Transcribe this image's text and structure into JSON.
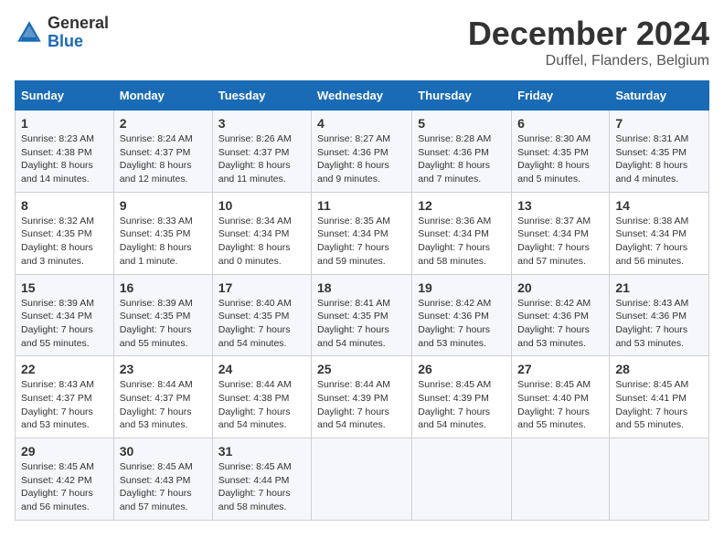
{
  "header": {
    "logo_general": "General",
    "logo_blue": "Blue",
    "month_title": "December 2024",
    "location": "Duffel, Flanders, Belgium"
  },
  "weekdays": [
    "Sunday",
    "Monday",
    "Tuesday",
    "Wednesday",
    "Thursday",
    "Friday",
    "Saturday"
  ],
  "weeks": [
    [
      {
        "day": "1",
        "sunrise": "Sunrise: 8:23 AM",
        "sunset": "Sunset: 4:38 PM",
        "daylight": "Daylight: 8 hours and 14 minutes."
      },
      {
        "day": "2",
        "sunrise": "Sunrise: 8:24 AM",
        "sunset": "Sunset: 4:37 PM",
        "daylight": "Daylight: 8 hours and 12 minutes."
      },
      {
        "day": "3",
        "sunrise": "Sunrise: 8:26 AM",
        "sunset": "Sunset: 4:37 PM",
        "daylight": "Daylight: 8 hours and 11 minutes."
      },
      {
        "day": "4",
        "sunrise": "Sunrise: 8:27 AM",
        "sunset": "Sunset: 4:36 PM",
        "daylight": "Daylight: 8 hours and 9 minutes."
      },
      {
        "day": "5",
        "sunrise": "Sunrise: 8:28 AM",
        "sunset": "Sunset: 4:36 PM",
        "daylight": "Daylight: 8 hours and 7 minutes."
      },
      {
        "day": "6",
        "sunrise": "Sunrise: 8:30 AM",
        "sunset": "Sunset: 4:35 PM",
        "daylight": "Daylight: 8 hours and 5 minutes."
      },
      {
        "day": "7",
        "sunrise": "Sunrise: 8:31 AM",
        "sunset": "Sunset: 4:35 PM",
        "daylight": "Daylight: 8 hours and 4 minutes."
      }
    ],
    [
      {
        "day": "8",
        "sunrise": "Sunrise: 8:32 AM",
        "sunset": "Sunset: 4:35 PM",
        "daylight": "Daylight: 8 hours and 3 minutes."
      },
      {
        "day": "9",
        "sunrise": "Sunrise: 8:33 AM",
        "sunset": "Sunset: 4:35 PM",
        "daylight": "Daylight: 8 hours and 1 minute."
      },
      {
        "day": "10",
        "sunrise": "Sunrise: 8:34 AM",
        "sunset": "Sunset: 4:34 PM",
        "daylight": "Daylight: 8 hours and 0 minutes."
      },
      {
        "day": "11",
        "sunrise": "Sunrise: 8:35 AM",
        "sunset": "Sunset: 4:34 PM",
        "daylight": "Daylight: 7 hours and 59 minutes."
      },
      {
        "day": "12",
        "sunrise": "Sunrise: 8:36 AM",
        "sunset": "Sunset: 4:34 PM",
        "daylight": "Daylight: 7 hours and 58 minutes."
      },
      {
        "day": "13",
        "sunrise": "Sunrise: 8:37 AM",
        "sunset": "Sunset: 4:34 PM",
        "daylight": "Daylight: 7 hours and 57 minutes."
      },
      {
        "day": "14",
        "sunrise": "Sunrise: 8:38 AM",
        "sunset": "Sunset: 4:34 PM",
        "daylight": "Daylight: 7 hours and 56 minutes."
      }
    ],
    [
      {
        "day": "15",
        "sunrise": "Sunrise: 8:39 AM",
        "sunset": "Sunset: 4:34 PM",
        "daylight": "Daylight: 7 hours and 55 minutes."
      },
      {
        "day": "16",
        "sunrise": "Sunrise: 8:39 AM",
        "sunset": "Sunset: 4:35 PM",
        "daylight": "Daylight: 7 hours and 55 minutes."
      },
      {
        "day": "17",
        "sunrise": "Sunrise: 8:40 AM",
        "sunset": "Sunset: 4:35 PM",
        "daylight": "Daylight: 7 hours and 54 minutes."
      },
      {
        "day": "18",
        "sunrise": "Sunrise: 8:41 AM",
        "sunset": "Sunset: 4:35 PM",
        "daylight": "Daylight: 7 hours and 54 minutes."
      },
      {
        "day": "19",
        "sunrise": "Sunrise: 8:42 AM",
        "sunset": "Sunset: 4:36 PM",
        "daylight": "Daylight: 7 hours and 53 minutes."
      },
      {
        "day": "20",
        "sunrise": "Sunrise: 8:42 AM",
        "sunset": "Sunset: 4:36 PM",
        "daylight": "Daylight: 7 hours and 53 minutes."
      },
      {
        "day": "21",
        "sunrise": "Sunrise: 8:43 AM",
        "sunset": "Sunset: 4:36 PM",
        "daylight": "Daylight: 7 hours and 53 minutes."
      }
    ],
    [
      {
        "day": "22",
        "sunrise": "Sunrise: 8:43 AM",
        "sunset": "Sunset: 4:37 PM",
        "daylight": "Daylight: 7 hours and 53 minutes."
      },
      {
        "day": "23",
        "sunrise": "Sunrise: 8:44 AM",
        "sunset": "Sunset: 4:37 PM",
        "daylight": "Daylight: 7 hours and 53 minutes."
      },
      {
        "day": "24",
        "sunrise": "Sunrise: 8:44 AM",
        "sunset": "Sunset: 4:38 PM",
        "daylight": "Daylight: 7 hours and 54 minutes."
      },
      {
        "day": "25",
        "sunrise": "Sunrise: 8:44 AM",
        "sunset": "Sunset: 4:39 PM",
        "daylight": "Daylight: 7 hours and 54 minutes."
      },
      {
        "day": "26",
        "sunrise": "Sunrise: 8:45 AM",
        "sunset": "Sunset: 4:39 PM",
        "daylight": "Daylight: 7 hours and 54 minutes."
      },
      {
        "day": "27",
        "sunrise": "Sunrise: 8:45 AM",
        "sunset": "Sunset: 4:40 PM",
        "daylight": "Daylight: 7 hours and 55 minutes."
      },
      {
        "day": "28",
        "sunrise": "Sunrise: 8:45 AM",
        "sunset": "Sunset: 4:41 PM",
        "daylight": "Daylight: 7 hours and 55 minutes."
      }
    ],
    [
      {
        "day": "29",
        "sunrise": "Sunrise: 8:45 AM",
        "sunset": "Sunset: 4:42 PM",
        "daylight": "Daylight: 7 hours and 56 minutes."
      },
      {
        "day": "30",
        "sunrise": "Sunrise: 8:45 AM",
        "sunset": "Sunset: 4:43 PM",
        "daylight": "Daylight: 7 hours and 57 minutes."
      },
      {
        "day": "31",
        "sunrise": "Sunrise: 8:45 AM",
        "sunset": "Sunset: 4:44 PM",
        "daylight": "Daylight: 7 hours and 58 minutes."
      },
      null,
      null,
      null,
      null
    ]
  ]
}
